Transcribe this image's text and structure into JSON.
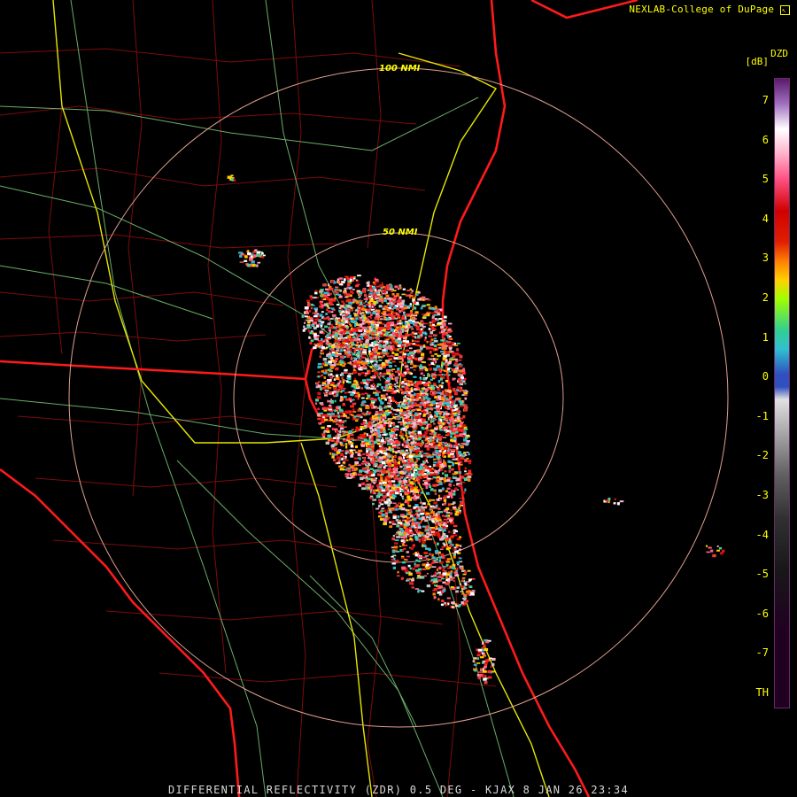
{
  "credit": "NEXLAB-College of DuPage",
  "credit_icon": "cursor-icon",
  "rings": {
    "inner_label": "50 NMI",
    "outer_label": "100 NMI"
  },
  "legend": {
    "product": "DZD",
    "unit": "[dB]",
    "ticks": [
      "7",
      "6",
      "5",
      "4",
      "3",
      "2",
      "1",
      "0",
      "-1",
      "-2",
      "-3",
      "-4",
      "-5",
      "-6",
      "-7",
      "TH"
    ]
  },
  "footer": "DIFFERENTIAL REFLECTIVITY (ZDR) 0.5 DEG - KJAX 8 JAN 26 23:34",
  "colors": {
    "state_border": "#ff1a1a",
    "county_border": "#9a1010",
    "highway": "#e0e000",
    "road": "#80d080",
    "range_ring": "#e0a090",
    "text": "#ffff00"
  }
}
